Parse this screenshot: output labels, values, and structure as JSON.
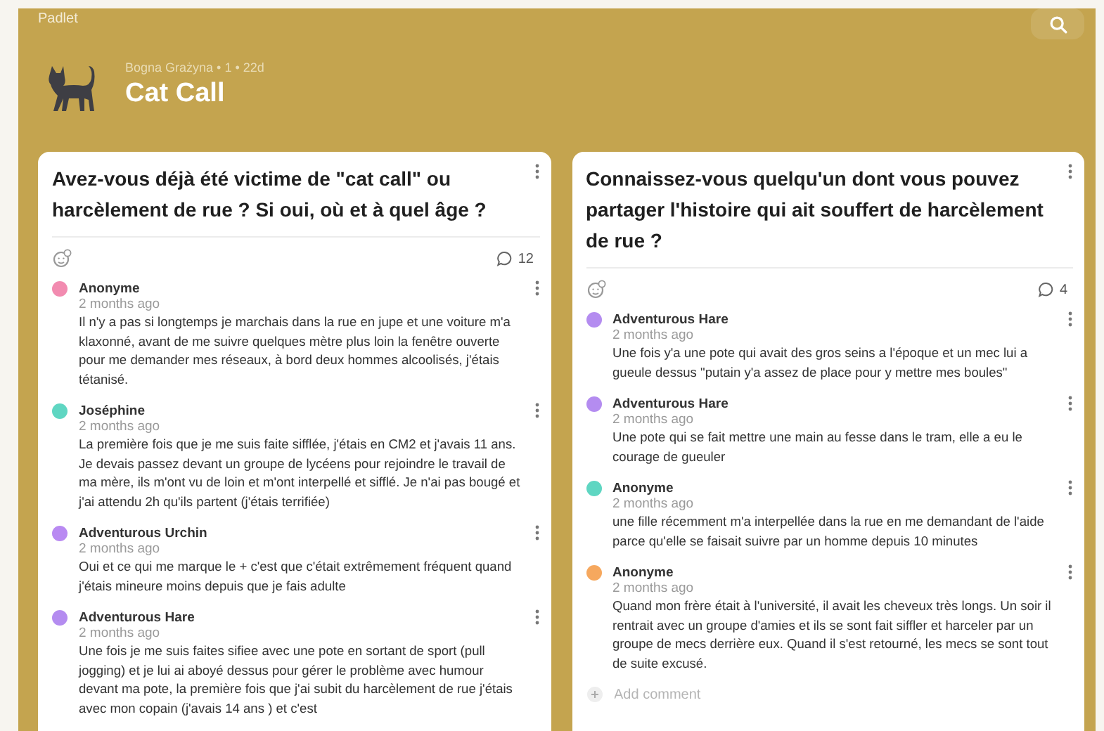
{
  "app": {
    "name": "Padlet"
  },
  "board": {
    "meta": "Bogna Grażyna • 1 • 22d",
    "title": "Cat Call"
  },
  "posts": [
    {
      "title": "Avez-vous déjà été victime de \"cat call\" ou harcèlement de rue ? Si oui, où et à quel âge ?",
      "comment_count": "12",
      "comments": [
        {
          "author": "Anonyme",
          "time": "2 months ago",
          "color": "#f28bb0",
          "text": "Il n'y a pas si longtemps je marchais dans la rue en jupe et une voiture m'a klaxonné, avant de me suivre quelques mètre plus loin la fenêtre ouverte pour me demander mes réseaux, à bord deux hommes alcoolisés, j'étais tétanisé."
        },
        {
          "author": "Joséphine",
          "time": "2 months ago",
          "color": "#5fd6c2",
          "text": "La première fois que je me suis faite sifflée, j'étais en CM2 et j'avais 11 ans. Je devais passez devant un groupe de lycéens pour rejoindre le travail de ma mère, ils m'ont vu de loin et m'ont interpellé et sifflé. Je n'ai pas bougé et j'ai attendu 2h qu'ils partent (j'étais terrifiée)"
        },
        {
          "author": "Adventurous Urchin",
          "time": "2 months ago",
          "color": "#b98af2",
          "text": "Oui et ce qui me marque le + c'est que c'était extrêmement fréquent quand j'étais mineure moins depuis que je fais adulte"
        },
        {
          "author": "Adventurous Hare",
          "time": "2 months ago",
          "color": "#b48cf0",
          "text": "Une fois je me suis faites sifiee avec une pote en sortant de sport (pull jogging) et je lui ai aboyé dessus pour gérer le problème avec humour  devant ma pote, la première fois que j'ai subit du harcèlement de rue j'étais avec mon copain (j'avais 14 ans ) et c'est"
        }
      ]
    },
    {
      "title": "Connaissez-vous quelqu'un dont vous pouvez partager l'histoire qui ait souffert de harcèlement de rue ?",
      "comment_count": "4",
      "comments": [
        {
          "author": "Adventurous Hare",
          "time": "2 months ago",
          "color": "#b48cf0",
          "text": "Une fois y'a une pote qui avait des gros seins a l'époque et un mec lui a gueule dessus \"putain y'a assez de place pour y mettre mes boules\""
        },
        {
          "author": "Adventurous Hare",
          "time": "2 months ago",
          "color": "#b48cf0",
          "text": "Une pote qui se fait mettre une main au fesse dans le tram, elle a eu le courage de gueuler"
        },
        {
          "author": "Anonyme",
          "time": "2 months ago",
          "color": "#5fd6c2",
          "text": "une fille récemment m'a interpellée dans la rue en me demandant de l'aide parce qu'elle se faisait suivre par un homme depuis 10 minutes"
        },
        {
          "author": "Anonyme",
          "time": "2 months ago",
          "color": "#f6a85e",
          "text": "Quand mon frère était à l'université, il avait les cheveux très longs. Un soir il rentrait avec un groupe d'amies et ils se sont fait siffler et harceler par un groupe de mecs derrière eux. Quand il s'est retourné, les mecs se sont tout de suite excusé."
        }
      ],
      "add_comment": {
        "placeholder": "Add comment"
      }
    }
  ]
}
